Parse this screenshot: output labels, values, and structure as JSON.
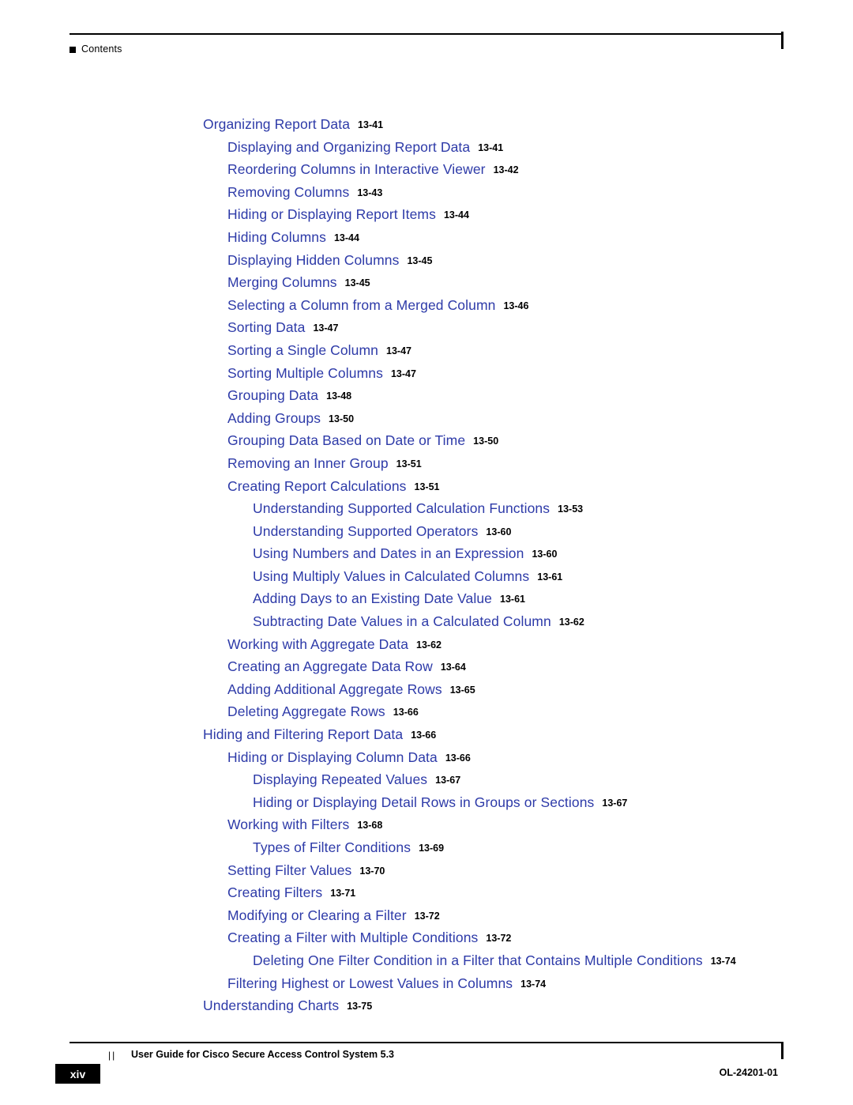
{
  "header": {
    "label": "Contents"
  },
  "toc": {
    "entries": [
      {
        "title": "Organizing Report Data",
        "page": "13-41",
        "level": 1
      },
      {
        "title": "Displaying and Organizing Report Data",
        "page": "13-41",
        "level": 2
      },
      {
        "title": "Reordering Columns in Interactive Viewer",
        "page": "13-42",
        "level": 2
      },
      {
        "title": "Removing Columns",
        "page": "13-43",
        "level": 2
      },
      {
        "title": "Hiding or Displaying Report Items",
        "page": "13-44",
        "level": 2
      },
      {
        "title": "Hiding Columns",
        "page": "13-44",
        "level": 2
      },
      {
        "title": "Displaying Hidden Columns",
        "page": "13-45",
        "level": 2
      },
      {
        "title": "Merging Columns",
        "page": "13-45",
        "level": 2
      },
      {
        "title": "Selecting a Column from a Merged Column",
        "page": "13-46",
        "level": 2
      },
      {
        "title": "Sorting Data",
        "page": "13-47",
        "level": 2
      },
      {
        "title": "Sorting a Single Column",
        "page": "13-47",
        "level": 2
      },
      {
        "title": "Sorting Multiple Columns",
        "page": "13-47",
        "level": 2
      },
      {
        "title": "Grouping Data",
        "page": "13-48",
        "level": 2
      },
      {
        "title": "Adding Groups",
        "page": "13-50",
        "level": 2
      },
      {
        "title": "Grouping Data Based on Date or Time",
        "page": "13-50",
        "level": 2
      },
      {
        "title": "Removing an Inner Group",
        "page": "13-51",
        "level": 2
      },
      {
        "title": "Creating Report Calculations",
        "page": "13-51",
        "level": 2
      },
      {
        "title": "Understanding Supported Calculation Functions",
        "page": "13-53",
        "level": 3
      },
      {
        "title": "Understanding Supported Operators",
        "page": "13-60",
        "level": 3
      },
      {
        "title": "Using Numbers and Dates in an Expression",
        "page": "13-60",
        "level": 3
      },
      {
        "title": "Using Multiply Values in Calculated Columns",
        "page": "13-61",
        "level": 3
      },
      {
        "title": "Adding Days to an Existing Date Value",
        "page": "13-61",
        "level": 3
      },
      {
        "title": "Subtracting Date Values in a Calculated Column",
        "page": "13-62",
        "level": 3
      },
      {
        "title": "Working with Aggregate Data",
        "page": "13-62",
        "level": 2
      },
      {
        "title": "Creating an Aggregate Data Row",
        "page": "13-64",
        "level": 2
      },
      {
        "title": "Adding Additional Aggregate Rows",
        "page": "13-65",
        "level": 2
      },
      {
        "title": "Deleting Aggregate Rows",
        "page": "13-66",
        "level": 2
      },
      {
        "title": "Hiding and Filtering Report Data",
        "page": "13-66",
        "level": 1
      },
      {
        "title": "Hiding or Displaying Column Data",
        "page": "13-66",
        "level": 2
      },
      {
        "title": "Displaying Repeated Values",
        "page": "13-67",
        "level": 3
      },
      {
        "title": "Hiding or Displaying Detail Rows in Groups or Sections",
        "page": "13-67",
        "level": 3
      },
      {
        "title": "Working with Filters",
        "page": "13-68",
        "level": 2
      },
      {
        "title": "Types of Filter Conditions",
        "page": "13-69",
        "level": 3
      },
      {
        "title": "Setting Filter Values",
        "page": "13-70",
        "level": 2
      },
      {
        "title": "Creating Filters",
        "page": "13-71",
        "level": 2
      },
      {
        "title": "Modifying or Clearing a Filter",
        "page": "13-72",
        "level": 2
      },
      {
        "title": "Creating a Filter with Multiple Conditions",
        "page": "13-72",
        "level": 2
      },
      {
        "title": "Deleting One Filter Condition in a Filter that Contains Multiple Conditions",
        "page": "13-74",
        "level": 3
      },
      {
        "title": "Filtering Highest or Lowest Values in Columns",
        "page": "13-74",
        "level": 2
      },
      {
        "title": "Understanding Charts",
        "page": "13-75",
        "level": 1
      }
    ]
  },
  "footer": {
    "title": "User Guide for Cisco Secure Access Control System 5.3",
    "page_number": "xiv",
    "doc_id": "OL-24201-01"
  }
}
